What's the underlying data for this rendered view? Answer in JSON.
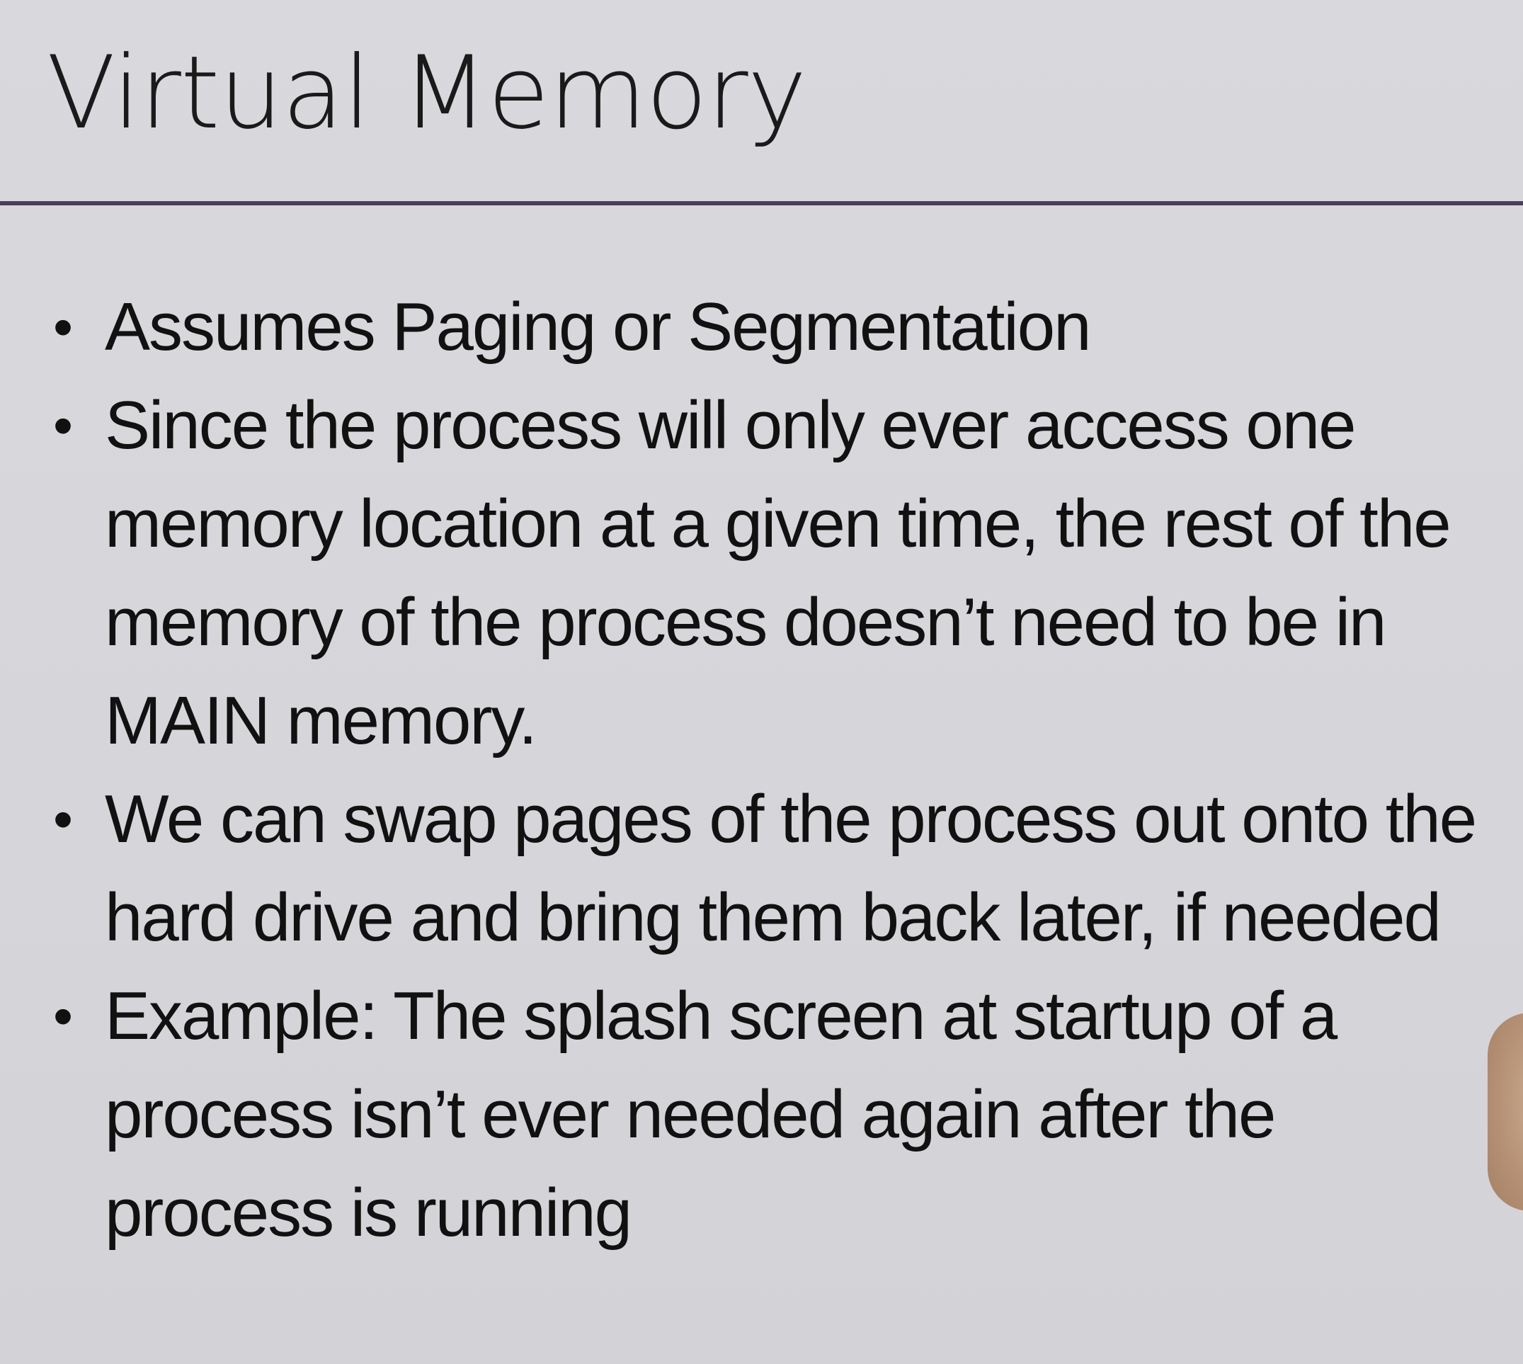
{
  "slide": {
    "title": "Virtual Memory",
    "bullets": [
      {
        "text": "Assumes Paging or Segmentation"
      },
      {
        "text": "Since the process will only ever access one memory location at a given  time, the rest of the memory of the process doesn’t need to be in MAIN memory."
      },
      {
        "text": "We can swap pages of the process out onto the hard drive and bring them back later, if needed"
      },
      {
        "text": "Example: The splash screen at startup of a process isn’t ever needed again after the process is running"
      }
    ],
    "bullet_symbol": "•"
  },
  "colors": {
    "background": "#d8d8dc",
    "text": "#111111",
    "rule": "#4a3f5a"
  }
}
